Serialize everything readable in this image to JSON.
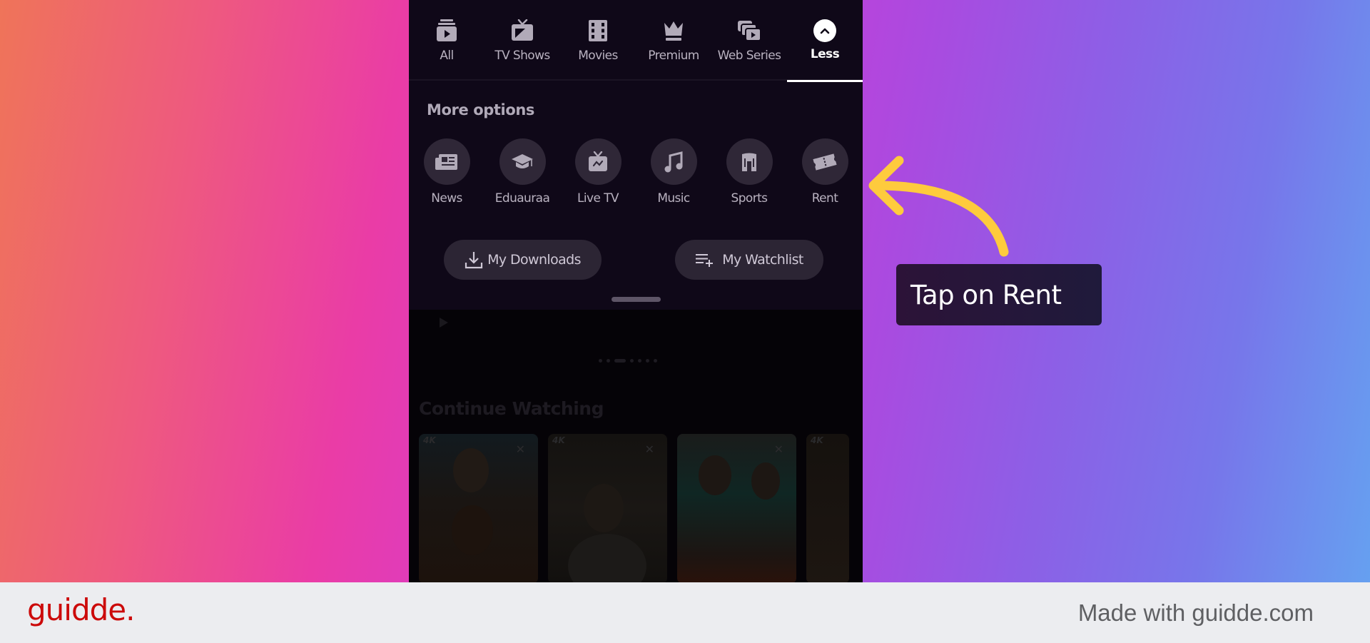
{
  "colors": {
    "accent_arrow": "#fecb3d",
    "brand_red": "#cc0a0a",
    "sheet_bg": "#0f0818",
    "option_circle": "#2f2737"
  },
  "top_nav": {
    "items": [
      {
        "label": "All",
        "icon": "all-content-icon"
      },
      {
        "label": "TV Shows",
        "icon": "tv-icon"
      },
      {
        "label": "Movies",
        "icon": "film-icon"
      },
      {
        "label": "Premium",
        "icon": "crown-icon"
      },
      {
        "label": "Web Series",
        "icon": "web-series-icon"
      },
      {
        "label": "Less",
        "icon": "chevron-up-icon",
        "active": true
      }
    ]
  },
  "more_options": {
    "title": "More options",
    "items": [
      {
        "label": "News",
        "icon": "newspaper-icon"
      },
      {
        "label": "Eduauraa",
        "icon": "graduation-cap-icon"
      },
      {
        "label": "Live TV",
        "icon": "live-tv-icon"
      },
      {
        "label": "Music",
        "icon": "music-note-icon"
      },
      {
        "label": "Sports",
        "icon": "sports-jersey-icon"
      },
      {
        "label": "Rent",
        "icon": "ticket-icon"
      }
    ]
  },
  "actions": {
    "downloads_label": "My Downloads",
    "watchlist_label": "My Watchlist"
  },
  "background": {
    "section_title": "Continue Watching",
    "card_badge": "4K",
    "close_glyph": "✕"
  },
  "annotation": {
    "callout_text": "Tap on Rent"
  },
  "footer": {
    "logo": "guidde.",
    "made_with": "Made with guidde.com"
  }
}
